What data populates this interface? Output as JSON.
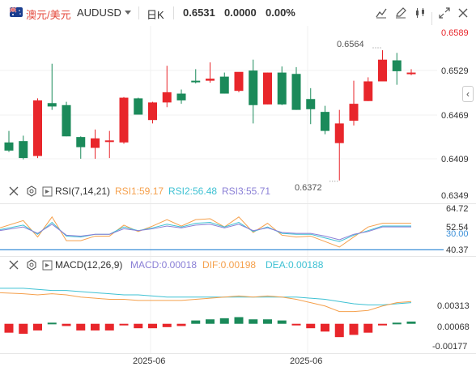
{
  "header": {
    "pair_cn": "澳元/美元",
    "pair_code": "AUDUSD",
    "period": "日K",
    "price": "0.6531",
    "change": "0.0000",
    "change_pct": "0.00%"
  },
  "toolbar": {
    "icons": [
      "indicator-icon",
      "edit-icon",
      "candle-type-icon",
      "fullscreen-icon",
      "close-icon"
    ]
  },
  "price_axis": [
    "0.6589",
    "0.6529",
    "0.6469",
    "0.6409",
    "0.6349"
  ],
  "annotations": {
    "high": "0.6564",
    "low": "0.6372"
  },
  "rsi": {
    "title": "RSI(7,14,21)",
    "rsi1": "RSI1:59.17",
    "rsi2": "RSI2:56.48",
    "rsi3": "RSI3:55.71",
    "axis": [
      "64.72",
      "52.54",
      "30.00",
      "40.37"
    ]
  },
  "macd": {
    "title": "MACD(12,26,9)",
    "macd": "MACD:0.00018",
    "dif": "DIF:0.00198",
    "dea": "DEA:0.00188",
    "axis": [
      "0.00313",
      "0.00068",
      "-0.00177"
    ]
  },
  "x_axis": [
    "2025-06",
    "2025-06"
  ],
  "colors": {
    "up": "#e8262b",
    "down": "#1b8a5a",
    "rsi1": "#f5a04c",
    "rsi2": "#3ec1d3",
    "rsi3": "#8a7fd6",
    "macd": "#8a7fd6",
    "dif": "#f5a04c",
    "dea": "#3ec1d3",
    "ref_line": "#3a8fd8"
  },
  "chart_data": [
    {
      "type": "candlestick",
      "ylim": [
        0.6349,
        0.6589
      ],
      "candles": [
        {
          "o": 0.6428,
          "h": 0.6445,
          "l": 0.6414,
          "c": 0.6416
        },
        {
          "o": 0.643,
          "h": 0.6438,
          "l": 0.6403,
          "c": 0.6405
        },
        {
          "o": 0.6408,
          "h": 0.6493,
          "l": 0.6405,
          "c": 0.649
        },
        {
          "o": 0.6486,
          "h": 0.6544,
          "l": 0.6476,
          "c": 0.6481
        },
        {
          "o": 0.6483,
          "h": 0.6488,
          "l": 0.6437,
          "c": 0.6437
        },
        {
          "o": 0.6436,
          "h": 0.6437,
          "l": 0.6404,
          "c": 0.6421
        },
        {
          "o": 0.642,
          "h": 0.6447,
          "l": 0.6404,
          "c": 0.6434
        },
        {
          "o": 0.6431,
          "h": 0.6445,
          "l": 0.6405,
          "c": 0.6431
        },
        {
          "o": 0.6428,
          "h": 0.6495,
          "l": 0.6426,
          "c": 0.6494
        },
        {
          "o": 0.6493,
          "h": 0.6494,
          "l": 0.6469,
          "c": 0.6469
        },
        {
          "o": 0.6461,
          "h": 0.6488,
          "l": 0.6456,
          "c": 0.6487
        },
        {
          "o": 0.6487,
          "h": 0.6541,
          "l": 0.648,
          "c": 0.6502
        },
        {
          "o": 0.65,
          "h": 0.6506,
          "l": 0.6485,
          "c": 0.649
        },
        {
          "o": 0.6519,
          "h": 0.6536,
          "l": 0.6515,
          "c": 0.6518
        },
        {
          "o": 0.6519,
          "h": 0.6546,
          "l": 0.6516,
          "c": 0.6522
        },
        {
          "o": 0.6525,
          "h": 0.6531,
          "l": 0.65,
          "c": 0.65
        },
        {
          "o": 0.6504,
          "h": 0.653,
          "l": 0.6502,
          "c": 0.6532
        },
        {
          "o": 0.6534,
          "h": 0.655,
          "l": 0.6456,
          "c": 0.6483
        },
        {
          "o": 0.6484,
          "h": 0.6531,
          "l": 0.6484,
          "c": 0.6531
        },
        {
          "o": 0.6531,
          "h": 0.654,
          "l": 0.6483,
          "c": 0.6484
        },
        {
          "o": 0.6529,
          "h": 0.6539,
          "l": 0.6476,
          "c": 0.6476
        },
        {
          "o": 0.6492,
          "h": 0.6508,
          "l": 0.6455,
          "c": 0.6477
        },
        {
          "o": 0.6473,
          "h": 0.6482,
          "l": 0.644,
          "c": 0.6445
        },
        {
          "o": 0.6427,
          "h": 0.6476,
          "l": 0.6372,
          "c": 0.6456
        },
        {
          "o": 0.646,
          "h": 0.6519,
          "l": 0.6453,
          "c": 0.6485
        },
        {
          "o": 0.6489,
          "h": 0.6524,
          "l": 0.6489,
          "c": 0.6518
        },
        {
          "o": 0.6518,
          "h": 0.6564,
          "l": 0.6519,
          "c": 0.655
        },
        {
          "o": 0.6549,
          "h": 0.656,
          "l": 0.6513,
          "c": 0.6533
        },
        {
          "o": 0.6531,
          "h": 0.6536,
          "l": 0.6527,
          "c": 0.6531
        }
      ]
    },
    {
      "type": "line",
      "name": "RSI",
      "ylim": [
        25,
        80
      ],
      "reference": 30,
      "series": [
        {
          "name": "RSI1",
          "values": [
            54,
            62,
            44,
            66,
            40,
            40,
            45,
            45,
            57,
            50,
            56,
            63,
            56,
            63,
            64,
            55,
            66,
            49,
            59,
            46,
            44,
            45,
            39,
            33,
            44,
            55,
            59,
            59,
            59
          ]
        },
        {
          "name": "RSI2",
          "values": [
            52,
            57,
            47,
            60,
            45,
            44,
            47,
            47,
            55,
            51,
            54,
            58,
            55,
            59,
            60,
            55,
            60,
            50,
            55,
            48,
            47,
            47,
            43,
            39,
            46,
            51,
            56,
            56,
            56
          ]
        },
        {
          "name": "RSI3",
          "values": [
            51,
            55,
            48,
            58,
            46,
            45,
            47,
            47,
            53,
            51,
            53,
            56,
            54,
            57,
            58,
            54,
            58,
            51,
            54,
            49,
            48,
            48,
            45,
            41,
            47,
            50,
            55,
            55,
            55
          ]
        }
      ]
    },
    {
      "type": "bar-line",
      "name": "MACD",
      "ylim": [
        -0.0025,
        0.0045
      ],
      "histogram": [
        -0.0008,
        -0.0009,
        -0.0006,
        0.0001,
        -0.0002,
        -0.0006,
        -0.0006,
        -0.0006,
        -0.0001,
        -0.0004,
        -0.0004,
        -0.0003,
        -0.0002,
        0.0003,
        0.0004,
        0.0005,
        0.0006,
        0.0004,
        0.0004,
        0.0003,
        -0.0001,
        -0.0004,
        -0.0007,
        -0.0012,
        -0.001,
        -0.0008,
        -0.0001,
        0.0001,
        0.0002
      ],
      "dif": [
        0.0028,
        0.0027,
        0.0026,
        0.0027,
        0.0026,
        0.0024,
        0.0023,
        0.0022,
        0.0022,
        0.0021,
        0.0021,
        0.0021,
        0.0021,
        0.0022,
        0.0023,
        0.0024,
        0.0025,
        0.0024,
        0.0025,
        0.0024,
        0.0022,
        0.0019,
        0.0016,
        0.0011,
        0.0011,
        0.0012,
        0.0016,
        0.0019,
        0.002
      ],
      "dea": [
        0.0032,
        0.0032,
        0.0031,
        0.003,
        0.003,
        0.0029,
        0.0028,
        0.0027,
        0.0026,
        0.0026,
        0.0025,
        0.0024,
        0.0024,
        0.0024,
        0.0024,
        0.0024,
        0.0024,
        0.0024,
        0.0024,
        0.0024,
        0.0024,
        0.0023,
        0.0022,
        0.002,
        0.0018,
        0.0017,
        0.0017,
        0.0018,
        0.0019
      ]
    }
  ]
}
